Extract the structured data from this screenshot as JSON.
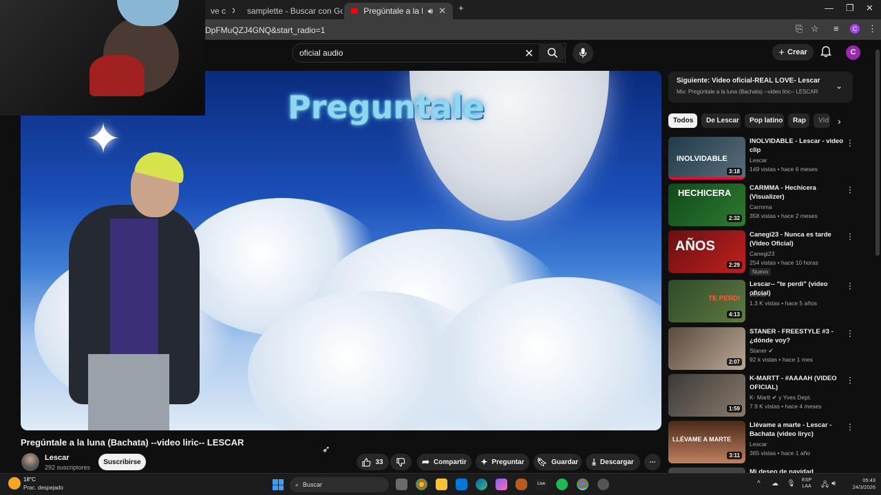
{
  "browser": {
    "tabs": [
      {
        "label": "ve c",
        "active": false
      },
      {
        "label": "samplette - Buscar con Google",
        "active": false
      },
      {
        "label": "Pregúntale a la luna (Bachat",
        "active": true
      }
    ],
    "url": "DpFMuQZJ4GNQ&start_radio=1",
    "profile_initial": "C"
  },
  "youtube": {
    "search": {
      "value": "oficial audio",
      "clear": "✕"
    },
    "create_label": "Crear",
    "avatar_initial": "C"
  },
  "video": {
    "overlay_title": "Preguntale",
    "title": "Pregúntale a la luna (Bachata) --video liric-- LESCAR",
    "channel": "Lescar",
    "subscribers": "292 suscriptores",
    "subscribe_label": "Suscribirse",
    "likes": "33",
    "actions": {
      "share": "Compartir",
      "ask": "Preguntar",
      "save": "Guardar",
      "download": "Descargar",
      "more": "⋯"
    }
  },
  "up_next": {
    "title": "Siguiente: Video oficial-REAL LOVE- Lescar",
    "subtitle": "Mix: Pregúntale a la luna (Bachata) --video liric-- LESCAR"
  },
  "chips": [
    "Todos",
    "De Lescar",
    "Pop latino",
    "Rap",
    "Vid"
  ],
  "recommendations": [
    {
      "title": "INOLVIDABLE - Lescar - video clip",
      "channel": "Lescar",
      "meta": "149 vistas • hace 6 meses",
      "duration": "3:18",
      "thumb_label": "INOLVIDABLE",
      "badge": ""
    },
    {
      "title": "CARMMA - Hechicera (Visualizer)",
      "channel": "Carmma",
      "meta": "358 vistas • hace 2 meses",
      "duration": "2:32",
      "thumb_label": "HECHICERA",
      "badge": ""
    },
    {
      "title": "Canegi23 - Nunca es tarde (Video Oficial)",
      "channel": "Canegi23",
      "meta": "254 vistas • hace 10 horas",
      "duration": "2:29",
      "thumb_label": "AÑOS",
      "badge": "Nuevo"
    },
    {
      "title": "Lescar-- \"te perdi\" (video oficial)",
      "channel": "Lescar",
      "meta": "1.3 K vistas • hace 5 años",
      "duration": "4:13",
      "thumb_label": "TE PERDI",
      "badge": ""
    },
    {
      "title": "STANER - FREESTYLE #3 - ¿dónde voy?",
      "channel": "Staner",
      "meta": "92 k vistas • hace 1 mes",
      "duration": "2:07",
      "thumb_label": "",
      "badge": ""
    },
    {
      "title": "K-MARTT - #AAAAH (VIDEO OFICIAL)",
      "channel": "K- Martt",
      "channel_extra": "y Yves Dept.",
      "meta": "7.9 K vistas • hace 4 meses",
      "duration": "1:59",
      "thumb_label": "",
      "badge": ""
    },
    {
      "title": "Llévame a marte - Lescar - Bachata (video liryc)",
      "channel": "Lescar",
      "meta": "365 vistas • hace 1 año",
      "duration": "3:11",
      "thumb_label": "LLÉVAME A MARTE",
      "badge": ""
    },
    {
      "title": "Mi deseo de navidad",
      "channel": "",
      "meta": "",
      "duration": "",
      "thumb_label": "",
      "badge": ""
    }
  ],
  "taskbar": {
    "weather_temp": "18°C",
    "weather_desc": "Prac. despejado",
    "search_label": "Buscar",
    "lang_top": "ESP",
    "lang_bottom": "LAA",
    "time": "05:43",
    "date": "24/3/2026"
  },
  "colors": {
    "accent_red": "#ff0033",
    "chip_active": "#f1f1f1",
    "avatar_purple": "#9c27b0"
  }
}
